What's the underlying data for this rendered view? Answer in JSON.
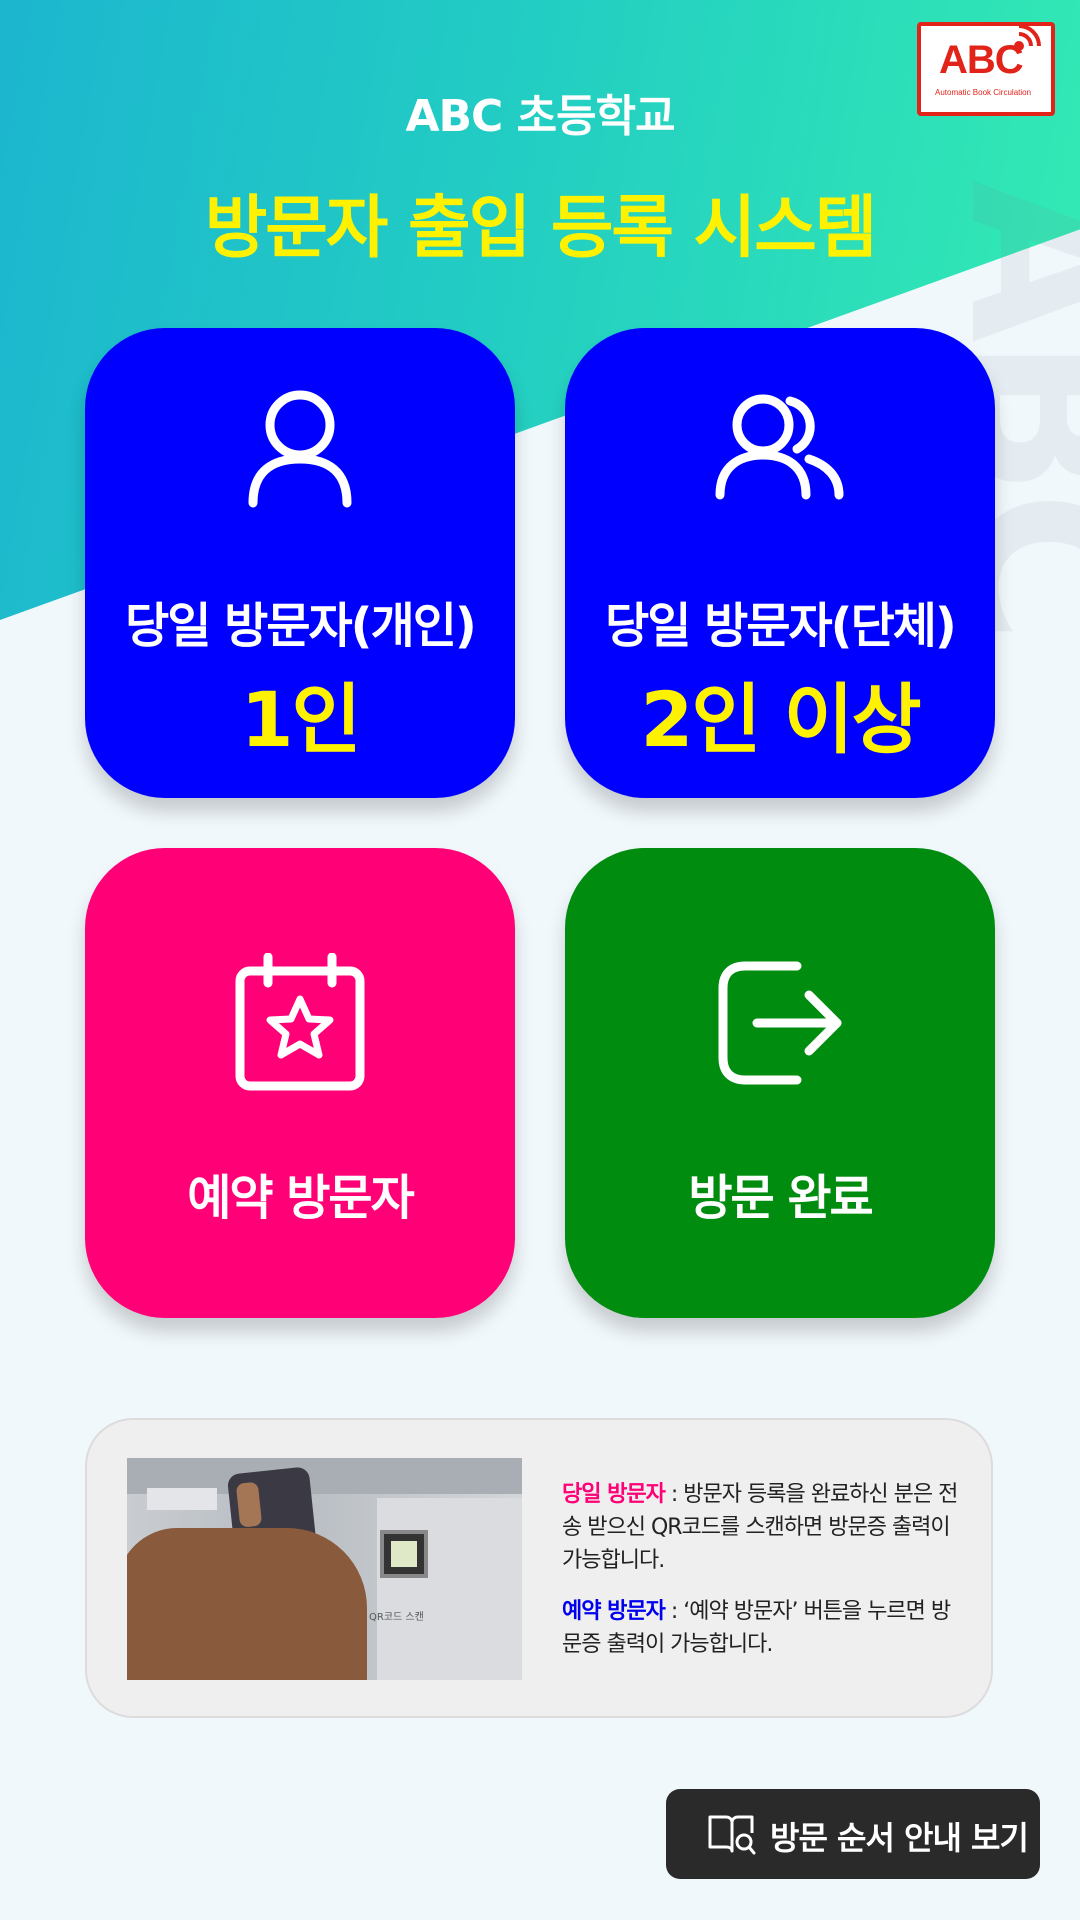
{
  "header": {
    "school_name": "ABC 초등학교",
    "system_title": "방문자 출입 등록 시스템"
  },
  "logo": {
    "text": "ABC",
    "tagline": "Automatic Book Circulation",
    "color": "#e2231a"
  },
  "tiles": [
    {
      "label": "당일 방문자(개인)",
      "sub": "1인",
      "icon": "person-icon",
      "color": "#0000ff"
    },
    {
      "label": "당일 방문자(단체)",
      "sub": "2인 이상",
      "icon": "group-icon",
      "color": "#0000ff"
    },
    {
      "label": "예약 방문자",
      "icon": "calendar-star-icon",
      "color": "#ff0077"
    },
    {
      "label": "방문 완료",
      "icon": "exit-icon",
      "color": "#008c0e"
    }
  ],
  "info": {
    "photo_caption": "QR코드 스캔",
    "same_day_key": "당일 방문자",
    "same_day_text": " : 방문자 등록을 완료하신 분은 전송 받으신 QR코드를 스캔하면 방문증 출력이 가능합니다.",
    "reserved_key": "예약 방문자",
    "reserved_text": " : ‘예약 방문자’ 버튼을 누르면 방문증 출력이 가능합니다."
  },
  "guide_button": {
    "label": "방문 순서 안내 보기",
    "icon": "book-search-icon"
  }
}
